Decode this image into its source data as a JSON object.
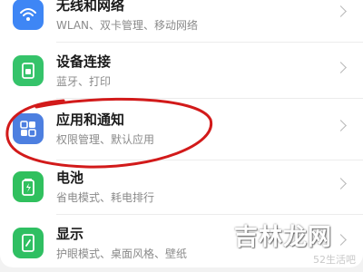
{
  "settings_list": {
    "items": [
      {
        "id": "wireless",
        "title": "无线和网络",
        "subtitle": "WLAN、双卡管理、移动网络",
        "icon": "wifi-icon",
        "icon_color": "#3e86f5"
      },
      {
        "id": "device",
        "title": "设备连接",
        "subtitle": "蓝牙、打印",
        "icon": "device-connect-icon",
        "icon_color": "#35c36a"
      },
      {
        "id": "apps",
        "title": "应用和通知",
        "subtitle": "权限管理、默认应用",
        "icon": "apps-grid-icon",
        "icon_color": "#4d7fe0"
      },
      {
        "id": "battery",
        "title": "电池",
        "subtitle": "省电模式、耗电排行",
        "icon": "battery-icon",
        "icon_color": "#30c05e"
      },
      {
        "id": "display",
        "title": "显示",
        "subtitle": "护眼模式、桌面风格、壁纸",
        "icon": "display-icon",
        "icon_color": "#2fbf62"
      }
    ]
  },
  "annotation": {
    "circled_item": "apps",
    "color": "#d21a1a"
  },
  "watermark": {
    "text": "吉林龙网",
    "site": "52生活吧"
  }
}
